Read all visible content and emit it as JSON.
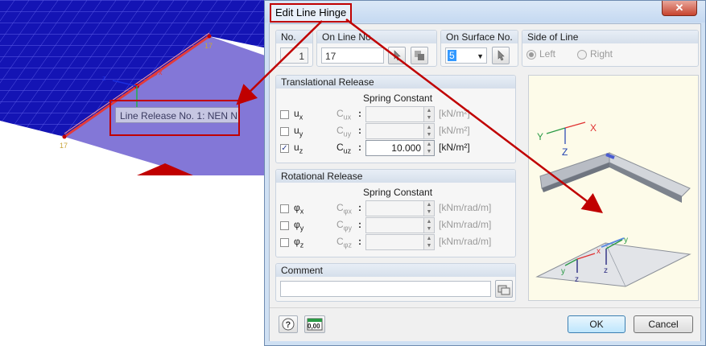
{
  "viewport": {
    "tooltip": "Line Release No. 1: NEN N",
    "node_labels": [
      "17",
      "17"
    ],
    "axis_labels": [
      "z",
      "x"
    ]
  },
  "dialog": {
    "title": "Edit Line Hinge",
    "close_glyph": "✕",
    "no": {
      "label": "No.",
      "value": "1"
    },
    "on_line": {
      "label": "On Line No.",
      "value": "17"
    },
    "on_surface": {
      "label": "On Surface No.",
      "value": "5"
    },
    "side": {
      "label": "Side of Line",
      "left": "Left",
      "right": "Right",
      "selected": "Left"
    },
    "translational": {
      "title": "Translational Release",
      "spring_header": "Spring Constant",
      "rows": [
        {
          "label": "u",
          "sub": "x",
          "cname": "C",
          "csub": "ux",
          "checked": false,
          "value": "",
          "unit": "[kN/m²]"
        },
        {
          "label": "u",
          "sub": "y",
          "cname": "C",
          "csub": "uy",
          "checked": false,
          "value": "",
          "unit": "[kN/m²]"
        },
        {
          "label": "u",
          "sub": "z",
          "cname": "C",
          "csub": "uz",
          "checked": true,
          "value": "10.000",
          "unit": "[kN/m²]"
        }
      ]
    },
    "rotational": {
      "title": "Rotational Release",
      "spring_header": "Spring Constant",
      "rows": [
        {
          "label": "φ",
          "sub": "x",
          "cname": "C",
          "csub": "φx",
          "checked": false,
          "value": "",
          "unit": "[kNm/rad/m]"
        },
        {
          "label": "φ",
          "sub": "y",
          "cname": "C",
          "csub": "φy",
          "checked": false,
          "value": "",
          "unit": "[kNm/rad/m]"
        },
        {
          "label": "φ",
          "sub": "z",
          "cname": "C",
          "csub": "φz",
          "checked": false,
          "value": "",
          "unit": "[kNm/rad/m]"
        }
      ]
    },
    "comment": {
      "label": "Comment",
      "value": ""
    },
    "colon": ":",
    "picture_axes": {
      "x": "X",
      "y": "Y",
      "z": "Z",
      "small_x": "x",
      "small_y": "y",
      "small_z": "z"
    },
    "units_button": "0,00",
    "ok": "OK",
    "cancel": "Cancel"
  },
  "colors": {
    "annotation_red": "#c00000",
    "surface_blue": "#1414b4",
    "accent": "#3c7fb1"
  }
}
